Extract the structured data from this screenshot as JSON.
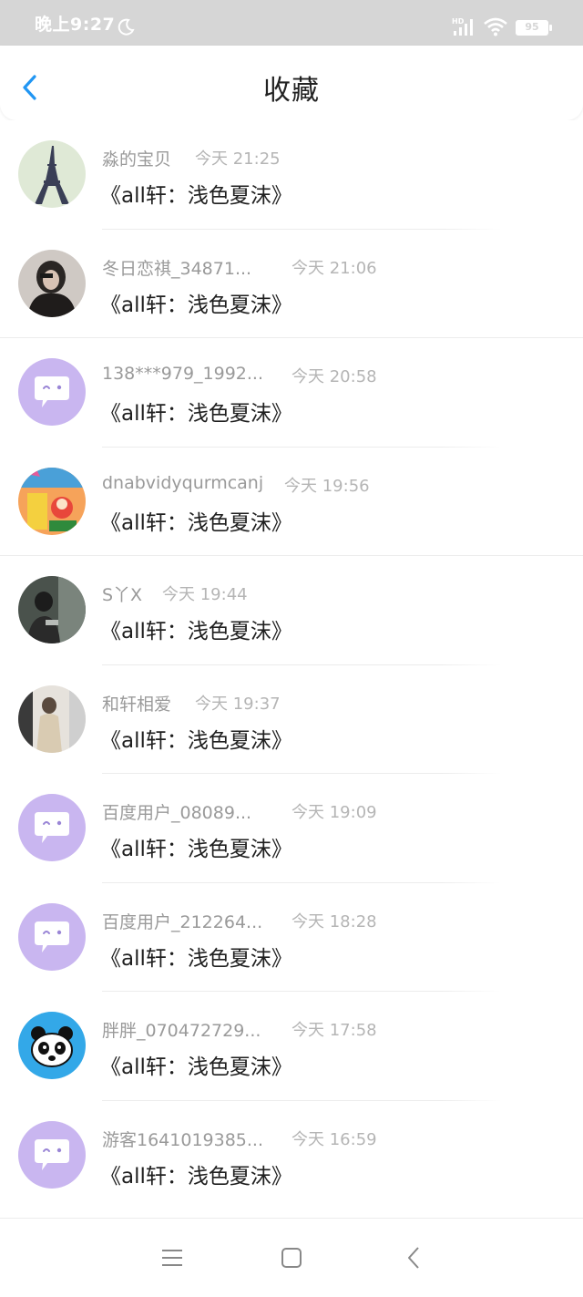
{
  "status_bar": {
    "time": "晚上9:27",
    "battery": "95",
    "icons": [
      "moon-icon",
      "hd-signal-icon",
      "wifi-icon",
      "battery-icon"
    ]
  },
  "header": {
    "title": "收藏",
    "back_icon": "chevron-left-icon",
    "accent_color": "#2196f3"
  },
  "items": [
    {
      "name": "淼的宝贝",
      "time": "今天 21:25",
      "content": "《all轩：浅色夏沫》",
      "avatar": "eiffel-tower"
    },
    {
      "name": "冬日恋祺_34871...",
      "time": "今天 21:06",
      "content": "《all轩：浅色夏沫》",
      "avatar": "photo-girl-dark"
    },
    {
      "name": "138***979_1992...",
      "time": "今天 20:58",
      "content": "《all轩：浅色夏沫》",
      "avatar": "default-chat-bubble"
    },
    {
      "name": "dnabvidyqurmcanj",
      "time": "今天 19:56",
      "content": "《all轩：浅色夏沫》",
      "avatar": "cartoon-colorful"
    },
    {
      "name": "S丫X",
      "time": "今天 19:44",
      "content": "《all轩：浅色夏沫》",
      "avatar": "photo-person-sitting"
    },
    {
      "name": "和轩相爱",
      "time": "今天 19:37",
      "content": "《all轩：浅色夏沫》",
      "avatar": "photo-person-window"
    },
    {
      "name": "百度用户_08089...",
      "time": "今天 19:09",
      "content": "《all轩：浅色夏沫》",
      "avatar": "default-chat-bubble"
    },
    {
      "name": "百度用户_212264...",
      "time": "今天 18:28",
      "content": "《all轩：浅色夏沫》",
      "avatar": "default-chat-bubble"
    },
    {
      "name": "胖胖_070472729...",
      "time": "今天 17:58",
      "content": "《all轩：浅色夏沫》",
      "avatar": "pixel-panda"
    },
    {
      "name": "游客1641019385...",
      "time": "今天 16:59",
      "content": "《all轩：浅色夏沫》",
      "avatar": "default-chat-bubble"
    }
  ],
  "nav_bar": {
    "buttons": [
      "menu-icon",
      "home-square-icon",
      "back-triangle-icon"
    ]
  }
}
